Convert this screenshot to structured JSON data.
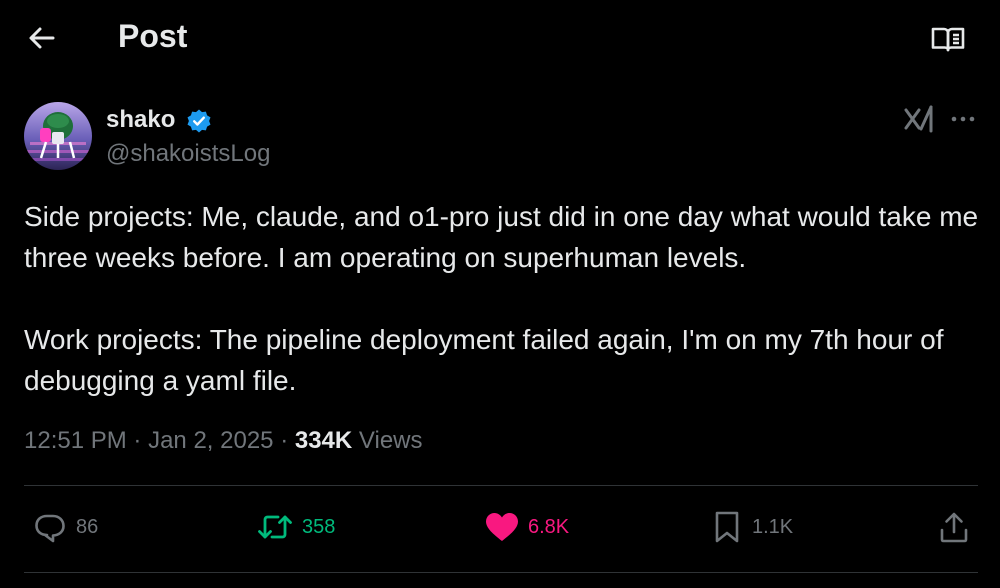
{
  "header": {
    "title": "Post"
  },
  "author": {
    "name": "shako",
    "handle": "@shakoistsLog"
  },
  "post": {
    "text": "Side projects: Me, claude, and o1-pro just did in one day what would take me three weeks before. I am operating on superhuman levels.\n\nWork projects: The pipeline deployment failed again, I'm on my 7th hour of debugging a yaml file.",
    "time": "12:51 PM",
    "date": "Jan 2, 2025",
    "sep": "·",
    "views_count": "334K",
    "views_label": "Views"
  },
  "actions": {
    "replies": "86",
    "reposts": "358",
    "likes": "6.8K",
    "bookmarks": "1.1K"
  },
  "colors": {
    "background": "#000000",
    "text": "#e7e9ea",
    "muted": "#71767b",
    "verified": "#1d9bf0",
    "repost": "#00ba7c",
    "like": "#f91880",
    "divider": "#2f3336"
  },
  "icons": [
    "back-arrow-icon",
    "reader-icon",
    "verified-badge-icon",
    "grok-icon",
    "more-icon",
    "reply-icon",
    "repost-icon",
    "like-icon",
    "bookmark-icon",
    "share-icon"
  ]
}
